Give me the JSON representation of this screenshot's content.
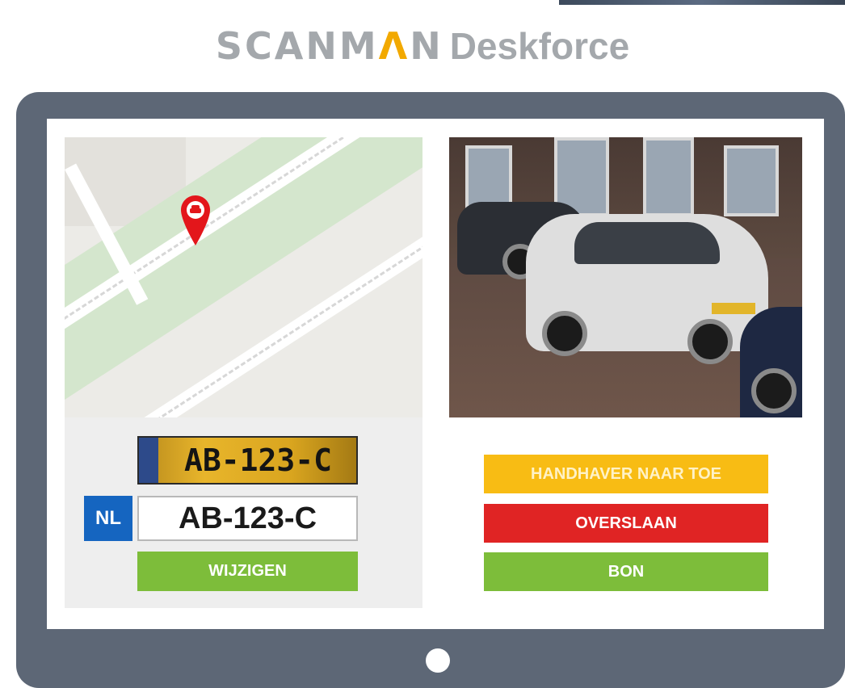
{
  "brand": {
    "name_part1": "SCANM",
    "name_accent": "Λ",
    "name_part2": "N",
    "product": "Deskforce",
    "logo_gray": "#a4a8ac",
    "logo_accent": "#f2a900"
  },
  "plates": {
    "recognized_plate": "AB-123-C",
    "country_code": "NL",
    "plate_value": "AB-123-C",
    "edit_label": "WIJZIGEN"
  },
  "actions": {
    "enforcer_label": "HANDHAVER NAAR TOE",
    "skip_label": "OVERSLAAN",
    "ticket_label": "BON"
  },
  "map": {
    "pin_icon": "car-location-pin-icon"
  },
  "colors": {
    "monitor_frame": "#5d6776",
    "green_button": "#7dbd3a",
    "yellow_button": "#f8bc14",
    "red_button": "#e02424",
    "nl_badge": "#1565c0"
  }
}
